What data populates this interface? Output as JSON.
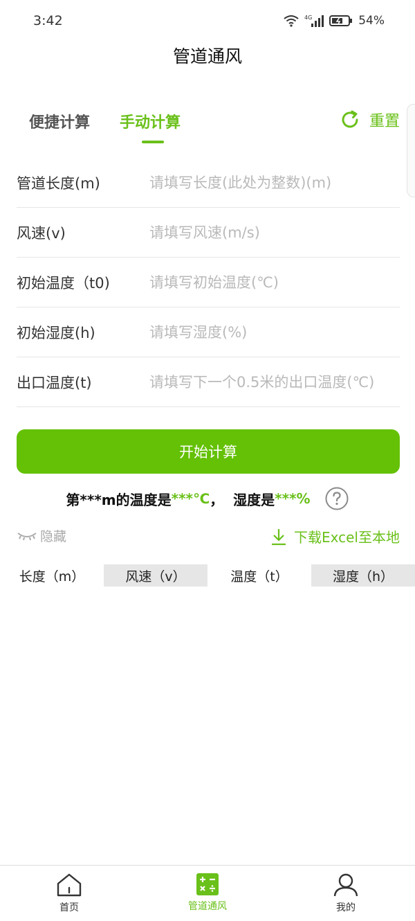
{
  "status_bar": {
    "time": "3:42",
    "network": "4G",
    "battery": "54%"
  },
  "header": {
    "title": "管道通风"
  },
  "tabs": [
    {
      "label": "便捷计算",
      "active": false
    },
    {
      "label": "手动计算",
      "active": true
    }
  ],
  "reset_label": "重置",
  "form": {
    "fields": [
      {
        "label": "管道长度(m)",
        "placeholder": "请填写长度(此处为整数)(m)",
        "value": ""
      },
      {
        "label": "风速(v)",
        "placeholder": "请填写风速(m/s)",
        "value": ""
      },
      {
        "label": "初始温度（t0)",
        "placeholder": "请填写初始温度(℃)",
        "value": ""
      },
      {
        "label": "初始湿度(h)",
        "placeholder": "请填写湿度(%)",
        "value": ""
      },
      {
        "label": "出口温度(t)",
        "placeholder": "请填写下一个0.5米的出口温度(℃)",
        "value": ""
      }
    ]
  },
  "calc_button": "开始计算",
  "result": {
    "prefix": "第***m的温度是",
    "temp": "***℃",
    "sep": "，  湿度是",
    "humidity": "***%"
  },
  "hide_label": "隐藏",
  "download_label": "下载Excel至本地",
  "table": {
    "headers": [
      "长度（m）",
      "风速（v）",
      "温度（t）",
      "湿度（h）"
    ]
  },
  "bottom_nav": [
    {
      "label": "首页",
      "icon": "home-icon",
      "active": false
    },
    {
      "label": "管道通风",
      "icon": "calculator-icon",
      "active": true
    },
    {
      "label": "我的",
      "icon": "user-icon",
      "active": false
    }
  ],
  "colors": {
    "accent": "#6ac01a",
    "button": "#64c105",
    "placeholder": "#b9b9b9"
  }
}
